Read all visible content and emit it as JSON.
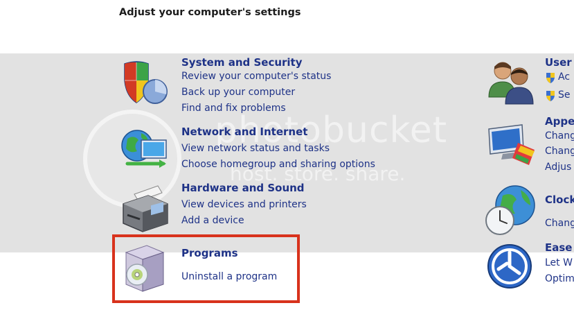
{
  "header": {
    "title": "Adjust your computer's settings"
  },
  "watermark": {
    "main": "photobucket",
    "sub": "host. store. share."
  },
  "left_categories": [
    {
      "title": "System and Security",
      "links": [
        "Review your computer's status",
        "Back up your computer",
        "Find and fix problems"
      ]
    },
    {
      "title": "Network and Internet",
      "links": [
        "View network status and tasks",
        "Choose homegroup and sharing options"
      ]
    },
    {
      "title": "Hardware and Sound",
      "links": [
        "View devices and printers",
        "Add a device"
      ]
    },
    {
      "title": "Programs",
      "links": [
        "Uninstall a program"
      ]
    }
  ],
  "right_categories": [
    {
      "title": "User",
      "links": [
        "Ac",
        "Se"
      ]
    },
    {
      "title": "Appe",
      "links": [
        "Chang",
        "Chang",
        "Adjus"
      ]
    },
    {
      "title": "Clock",
      "links": [
        "Chang"
      ]
    },
    {
      "title": "Ease",
      "links": [
        "Let W",
        "Optim"
      ]
    }
  ],
  "colors": {
    "link": "#1e3287",
    "band": "#e2e2e2",
    "highlight": "#d8321c"
  },
  "icons": [
    "security-shield-icon",
    "network-globe-icon",
    "printer-icon",
    "programs-box-icon",
    "users-icon",
    "appearance-monitor-icon",
    "clock-globe-icon",
    "ease-of-access-icon",
    "uac-shield-icon"
  ]
}
